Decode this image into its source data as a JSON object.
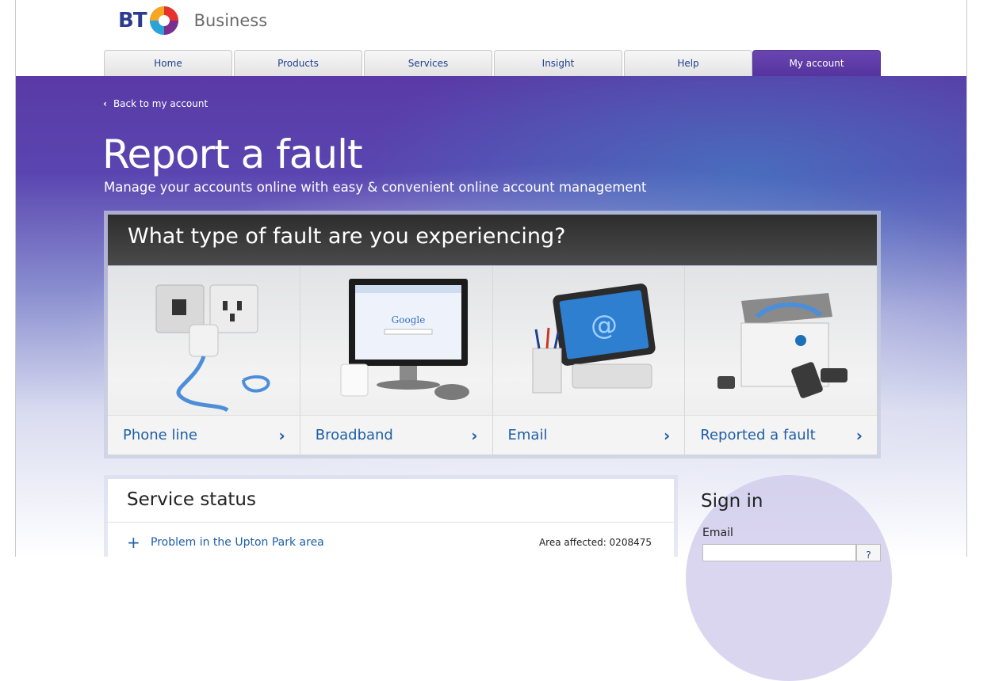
{
  "brand": {
    "logo_text": "BT",
    "division": "Business"
  },
  "nav": {
    "tabs": [
      {
        "label": "Home"
      },
      {
        "label": "Products"
      },
      {
        "label": "Services"
      },
      {
        "label": "Insight"
      },
      {
        "label": "Help"
      },
      {
        "label": "My account"
      }
    ],
    "active": "My account"
  },
  "back_link": "Back to my account",
  "page_title": "Report a fault",
  "subtitle": "Manage your accounts online with easy & convenient online account management",
  "fault_panel": {
    "question": "What type of fault are you experiencing?",
    "options": [
      {
        "label": "Phone line",
        "icon": "phone-socket-icon"
      },
      {
        "label": "Broadband",
        "icon": "computer-monitor-icon"
      },
      {
        "label": "Email",
        "icon": "email-tablet-icon"
      },
      {
        "label": "Reported a fault",
        "icon": "engineer-toolbox-icon"
      }
    ]
  },
  "service_status": {
    "title": "Service status",
    "items": [
      {
        "text": "Problem in the Upton Park area",
        "area": "Area affected: 0208475"
      }
    ]
  },
  "sign_in": {
    "title": "Sign in",
    "email_label": "Email",
    "help_label": "?"
  },
  "colors": {
    "brand_purple": "#5a3aa6",
    "link_blue": "#1f5ea8",
    "tab_text": "#1f3f8f"
  }
}
